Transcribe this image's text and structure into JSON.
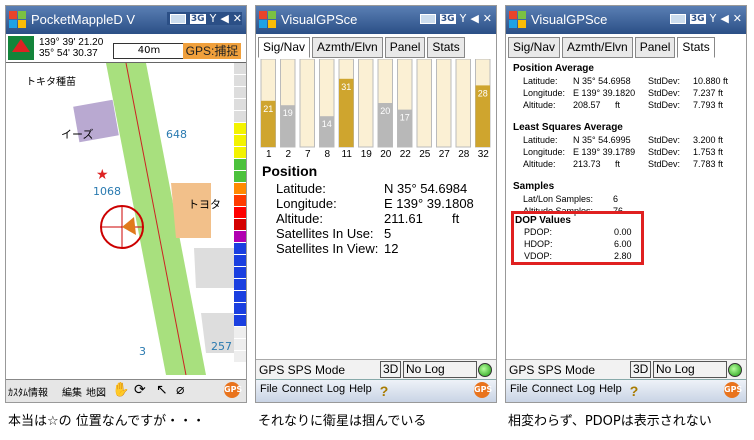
{
  "p1": {
    "title": "PocketMappleD V",
    "coord_lon": "139° 39' 21.20",
    "coord_lat": "35° 54' 30.37",
    "scale": "40m",
    "gps_btn": "GPS:捕捉",
    "map_labels": {
      "place1": "トキタ種苗",
      "place2": "イーズ",
      "num648": "648",
      "num1068": "1068",
      "toyota": "トヨタ",
      "num257": "257",
      "num3": "3"
    },
    "bottom_items": [
      "ｶｽﾀﾑ情報",
      "編集",
      "地図"
    ],
    "caption": "本当は☆の 位置なんですが・・・"
  },
  "p2": {
    "title": "VisualGPSce",
    "tabs": [
      "Sig/Nav",
      "Azmth/Elvn",
      "Panel",
      "Stats"
    ],
    "bars": [
      {
        "prn": "1",
        "snr": 21,
        "color": "#cfa52e"
      },
      {
        "prn": "2",
        "snr": 19,
        "color": "#b8b8b8"
      },
      {
        "prn": "7",
        "snr": 0,
        "color": "#b8b8b8"
      },
      {
        "prn": "8",
        "snr": 14,
        "color": "#b8b8b8"
      },
      {
        "prn": "11",
        "snr": 31,
        "color": "#cfa52e"
      },
      {
        "prn": "19",
        "snr": 0,
        "color": "#cfa52e"
      },
      {
        "prn": "20",
        "snr": 20,
        "color": "#b8b8b8"
      },
      {
        "prn": "22",
        "snr": 17,
        "color": "#b8b8b8"
      },
      {
        "prn": "25",
        "snr": 0,
        "color": "#b8b8b8"
      },
      {
        "prn": "27",
        "snr": 0,
        "color": "#b8b8b8"
      },
      {
        "prn": "28",
        "snr": 0,
        "color": "#cfa52e"
      },
      {
        "prn": "32",
        "snr": 28,
        "color": "#cfa52e"
      }
    ],
    "position": {
      "header": "Position",
      "latitude_label": "Latitude:",
      "latitude": "N 35° 54.6984",
      "longitude_label": "Longitude:",
      "longitude": "E 139° 39.1808",
      "altitude_label": "Altitude:",
      "altitude": "211.61",
      "altitude_unit": "ft",
      "sats_use_label": "Satellites In Use:",
      "sats_use": "5",
      "sats_view_label": "Satellites In View:",
      "sats_view": "12"
    },
    "status": {
      "mode": "GPS SPS Mode",
      "dim": "3D",
      "log": "No Log"
    },
    "menu": [
      "File",
      "Connect",
      "Log",
      "Help"
    ],
    "caption": "それなりに衛星は掴んでいる"
  },
  "p3": {
    "title": "VisualGPSce",
    "tabs": [
      "Sig/Nav",
      "Azmth/Elvn",
      "Panel",
      "Stats"
    ],
    "pos_avg": {
      "header": "Position Average",
      "lat_label": "Latitude:",
      "lat": "N 35° 54.6958",
      "lat_sd": "10.880 ft",
      "lon_label": "Longitude:",
      "lon": "E 139° 39.1820",
      "lon_sd": "7.237 ft",
      "alt_label": "Altitude:",
      "alt": "208.57",
      "alt_unit": "ft",
      "alt_sd": "7.793 ft",
      "sd_label": "StdDev:"
    },
    "lsq_avg": {
      "header": "Least Squares Average",
      "lat_label": "Latitude:",
      "lat": "N 35° 54.6995",
      "lat_sd": "3.200 ft",
      "lon_label": "Longitude:",
      "lon": "E 139° 39.1789",
      "lon_sd": "1.753 ft",
      "alt_label": "Altitude:",
      "alt": "213.73",
      "alt_unit": "ft",
      "alt_sd": "7.783 ft",
      "sd_label": "StdDev:"
    },
    "samples": {
      "header": "Samples",
      "latlon_label": "Lat/Lon Samples:",
      "latlon": "6",
      "alt_label": "Altitude Samples:",
      "alt": "76"
    },
    "dop": {
      "header": "DOP Values",
      "pdop_label": "PDOP:",
      "pdop": "0.00",
      "hdop_label": "HDOP:",
      "hdop": "6.00",
      "vdop_label": "VDOP:",
      "vdop": "2.80"
    },
    "status": {
      "mode": "GPS SPS Mode",
      "dim": "3D",
      "log": "No Log"
    },
    "menu": [
      "File",
      "Connect",
      "Log",
      "Help"
    ],
    "caption": "相変わらず、PDOPは表示されない"
  }
}
